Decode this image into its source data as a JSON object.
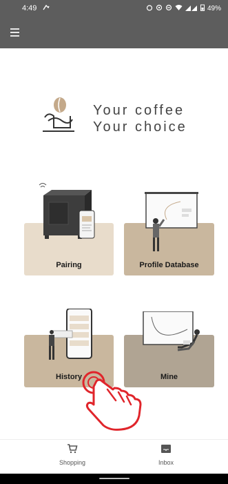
{
  "status_bar": {
    "time": "4:49",
    "battery": "49%"
  },
  "header": {
    "menu_icon": "hamburger-menu-icon"
  },
  "hero": {
    "tagline_line1": "Your coffee",
    "tagline_line2": "Your choice"
  },
  "cards": [
    {
      "label": "Pairing"
    },
    {
      "label": "Profile Database"
    },
    {
      "label": "History"
    },
    {
      "label": "Mine"
    }
  ],
  "bottom_nav": [
    {
      "label": "Shopping",
      "icon": "cart-icon"
    },
    {
      "label": "Inbox",
      "icon": "inbox-icon"
    }
  ],
  "colors": {
    "bar": "#5d5d5d",
    "card_light": "#e8dccb",
    "card_dark": "#c9b79e",
    "card_mine": "#b0a493",
    "hand": "#e0252b"
  }
}
